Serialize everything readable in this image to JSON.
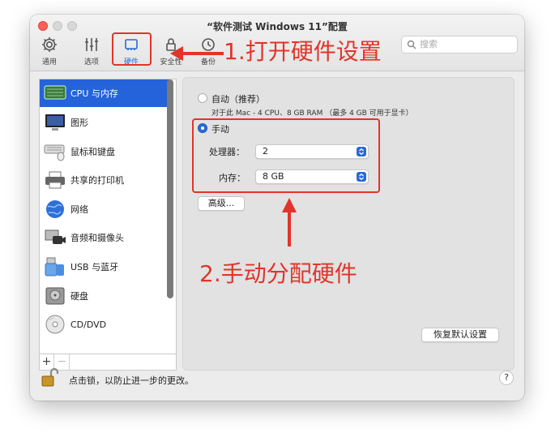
{
  "window": {
    "title": "“软件测试 Windows 11”配置"
  },
  "toolbar": {
    "items": [
      {
        "label": "通用",
        "icon": "gear-icon"
      },
      {
        "label": "选项",
        "icon": "sliders-icon"
      },
      {
        "label": "硬件",
        "icon": "hardware-icon"
      },
      {
        "label": "安全性",
        "icon": "lock-icon"
      },
      {
        "label": "备份",
        "icon": "clock-icon"
      }
    ],
    "search_placeholder": "搜索"
  },
  "sidebar": {
    "items": [
      {
        "label": "CPU 与内存",
        "icon": "cpu-icon"
      },
      {
        "label": "图形",
        "icon": "monitor-icon"
      },
      {
        "label": "鼠标和键盘",
        "icon": "keyboard-icon"
      },
      {
        "label": "共享的打印机",
        "icon": "printer-icon"
      },
      {
        "label": "网络",
        "icon": "globe-icon"
      },
      {
        "label": "音频和摄像头",
        "icon": "camera-icon"
      },
      {
        "label": "USB 与蓝牙",
        "icon": "usb-icon"
      },
      {
        "label": "硬盘",
        "icon": "disk-icon"
      },
      {
        "label": "CD/DVD",
        "icon": "cd-icon"
      }
    ],
    "add_label": "+",
    "remove_label": "−"
  },
  "cpu_memory": {
    "auto_label": "自动（推荐）",
    "auto_desc": "对于此 Mac - 4 CPU、8 GB RAM （最多 4 GB 可用于显卡）",
    "manual_label": "手动",
    "processor_label": "处理器：",
    "processor_value": "2",
    "memory_label": "内存：",
    "memory_value": "8 GB",
    "advanced_button": "高级...",
    "restore_button": "恢复默认设置"
  },
  "status": {
    "lock_text": "点击锁，以防止进一步的更改。",
    "help_label": "?"
  },
  "annotations": {
    "step1": "1.打开硬件设置",
    "step2": "2.手动分配硬件"
  },
  "colors": {
    "accent": "#2a6ad8",
    "annotation": "#e2342a",
    "selection": "#2463d9"
  }
}
